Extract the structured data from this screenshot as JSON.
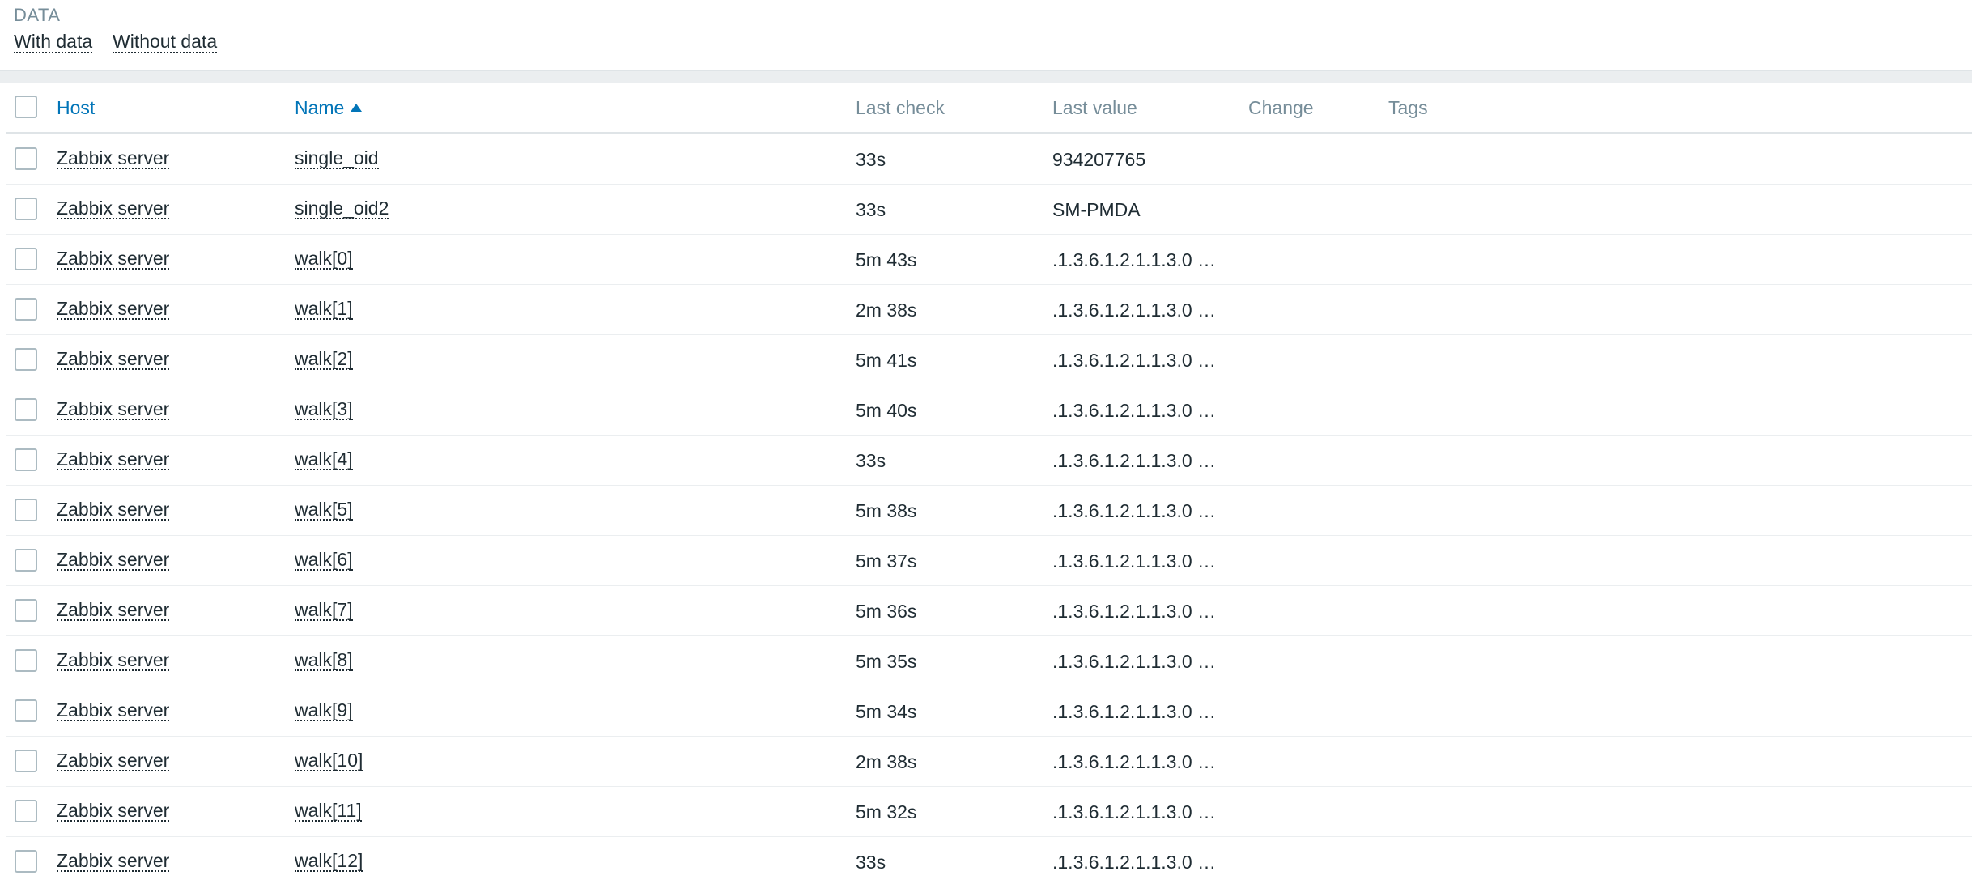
{
  "filter": {
    "title": "DATA",
    "options": [
      "With data",
      "Without data"
    ]
  },
  "table": {
    "columns": {
      "host": "Host",
      "name": "Name",
      "last_check": "Last check",
      "last_value": "Last value",
      "change": "Change",
      "tags": "Tags"
    },
    "rows": [
      {
        "host": "Zabbix server",
        "name": "single_oid",
        "last_check": "33s",
        "last_value": "934207765"
      },
      {
        "host": "Zabbix server",
        "name": "single_oid2",
        "last_check": "33s",
        "last_value": "SM-PMDA"
      },
      {
        "host": "Zabbix server",
        "name": "walk[0]",
        "last_check": "5m 43s",
        "last_value": ".1.3.6.1.2.1.1.3.0 …"
      },
      {
        "host": "Zabbix server",
        "name": "walk[1]",
        "last_check": "2m 38s",
        "last_value": ".1.3.6.1.2.1.1.3.0 …"
      },
      {
        "host": "Zabbix server",
        "name": "walk[2]",
        "last_check": "5m 41s",
        "last_value": ".1.3.6.1.2.1.1.3.0 …"
      },
      {
        "host": "Zabbix server",
        "name": "walk[3]",
        "last_check": "5m 40s",
        "last_value": ".1.3.6.1.2.1.1.3.0 …"
      },
      {
        "host": "Zabbix server",
        "name": "walk[4]",
        "last_check": "33s",
        "last_value": ".1.3.6.1.2.1.1.3.0 …"
      },
      {
        "host": "Zabbix server",
        "name": "walk[5]",
        "last_check": "5m 38s",
        "last_value": ".1.3.6.1.2.1.1.3.0 …"
      },
      {
        "host": "Zabbix server",
        "name": "walk[6]",
        "last_check": "5m 37s",
        "last_value": ".1.3.6.1.2.1.1.3.0 …"
      },
      {
        "host": "Zabbix server",
        "name": "walk[7]",
        "last_check": "5m 36s",
        "last_value": ".1.3.6.1.2.1.1.3.0 …"
      },
      {
        "host": "Zabbix server",
        "name": "walk[8]",
        "last_check": "5m 35s",
        "last_value": ".1.3.6.1.2.1.1.3.0 …"
      },
      {
        "host": "Zabbix server",
        "name": "walk[9]",
        "last_check": "5m 34s",
        "last_value": ".1.3.6.1.2.1.1.3.0 …"
      },
      {
        "host": "Zabbix server",
        "name": "walk[10]",
        "last_check": "2m 38s",
        "last_value": ".1.3.6.1.2.1.1.3.0 …"
      },
      {
        "host": "Zabbix server",
        "name": "walk[11]",
        "last_check": "5m 32s",
        "last_value": ".1.3.6.1.2.1.1.3.0 …"
      },
      {
        "host": "Zabbix server",
        "name": "walk[12]",
        "last_check": "33s",
        "last_value": ".1.3.6.1.2.1.1.3.0 …"
      }
    ]
  }
}
